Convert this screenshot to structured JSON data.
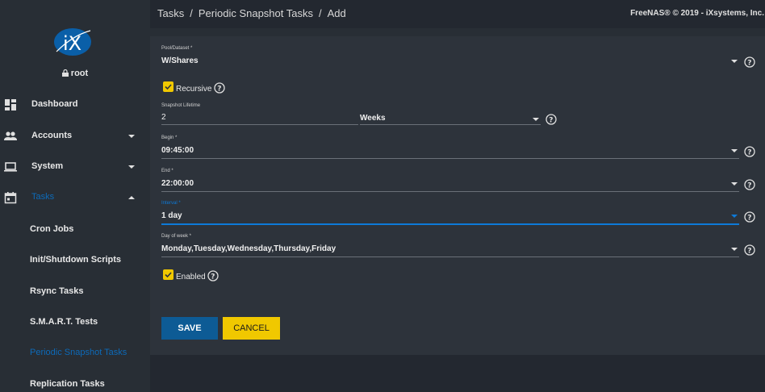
{
  "header": {
    "breadcrumb": [
      "Tasks",
      "Periodic Snapshot Tasks",
      "Add"
    ],
    "breadcrumb_sep": "/",
    "copyright": "FreeNAS® © 2019 - iXsystems, Inc."
  },
  "sidebar": {
    "logo_text": "iX",
    "user": "root",
    "items": [
      {
        "label": "Dashboard",
        "icon": "dashboard-icon"
      },
      {
        "label": "Accounts",
        "icon": "people-icon"
      },
      {
        "label": "System",
        "icon": "laptop-icon"
      },
      {
        "label": "Tasks",
        "icon": "calendar-icon"
      }
    ],
    "sub_items": [
      "Cron Jobs",
      "Init/Shutdown Scripts",
      "Rsync Tasks",
      "S.M.A.R.T. Tests",
      "Periodic Snapshot Tasks",
      "Replication Tasks"
    ]
  },
  "form": {
    "pool_label": "Pool/Dataset *",
    "pool_value": "W/Shares",
    "recursive_label": "Recursive",
    "lifetime_label": "Snapshot Lifetime",
    "lifetime_value": "2",
    "lifetime_unit": "Weeks",
    "begin_label": "Begin *",
    "begin_value": "09:45:00",
    "end_label": "End *",
    "end_value": "22:00:00",
    "interval_label": "Interval *",
    "interval_value": "1 day",
    "dow_label": "Day of week *",
    "dow_value": "Monday,Tuesday,Wednesday,Thursday,Friday",
    "enabled_label": "Enabled"
  },
  "buttons": {
    "save": "SAVE",
    "cancel": "CANCEL"
  },
  "colors": {
    "accent": "#0d6ab8",
    "checkbox": "#f0c800",
    "save_button": "#0d5b95"
  }
}
